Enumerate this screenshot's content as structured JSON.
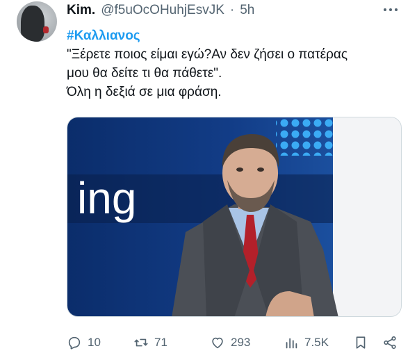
{
  "author": {
    "name": "Kim.",
    "handle": "@f5uOcOHuhjEsvJK",
    "separator": "·",
    "time": "5h"
  },
  "tweet": {
    "hashtag": "#Καλλιανος",
    "lines": [
      "\"Ξέρετε ποιος είμαι εγώ?Αν δεν ζήσει ο πατέρας",
      "μου θα δείτε τι θα πάθετε\".",
      "Όλη η δεξιά σε μια φράση."
    ]
  },
  "media": {
    "screen_text": "ing"
  },
  "actions": {
    "replies": "10",
    "retweets": "71",
    "likes": "293",
    "views": "7.5K"
  },
  "icons": {
    "reply": "reply-icon",
    "retweet": "retweet-icon",
    "like": "heart-icon",
    "views": "views-icon",
    "bookmark": "bookmark-icon",
    "share": "share-icon",
    "more": "more-icon"
  },
  "colors": {
    "link": "#1d9bf0",
    "muted": "#536471",
    "text": "#0f1419"
  }
}
